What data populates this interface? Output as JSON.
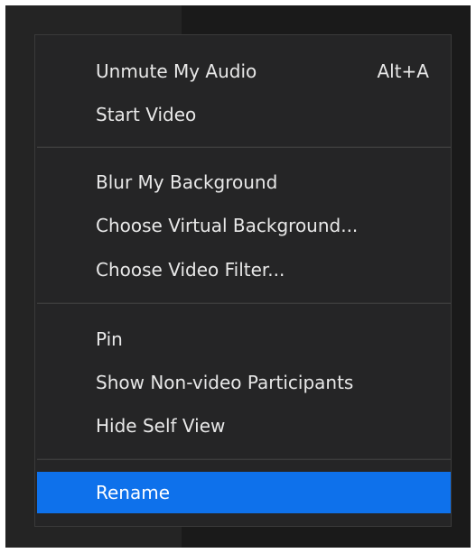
{
  "menu": {
    "groups": [
      {
        "items": [
          {
            "label": "Unmute My Audio",
            "shortcut": "Alt+A"
          },
          {
            "label": "Start Video"
          }
        ]
      },
      {
        "items": [
          {
            "label": "Blur My Background"
          },
          {
            "label": "Choose Virtual Background..."
          },
          {
            "label": "Choose Video Filter..."
          }
        ]
      },
      {
        "items": [
          {
            "label": "Pin"
          },
          {
            "label": "Show Non-video Participants"
          },
          {
            "label": "Hide Self View"
          }
        ]
      },
      {
        "items": [
          {
            "label": "Rename",
            "selected": true
          }
        ]
      }
    ],
    "colors": {
      "background": "#252526",
      "text": "#e8e8e8",
      "highlight": "#0e71eb",
      "separator": "#3c3c3c"
    }
  }
}
